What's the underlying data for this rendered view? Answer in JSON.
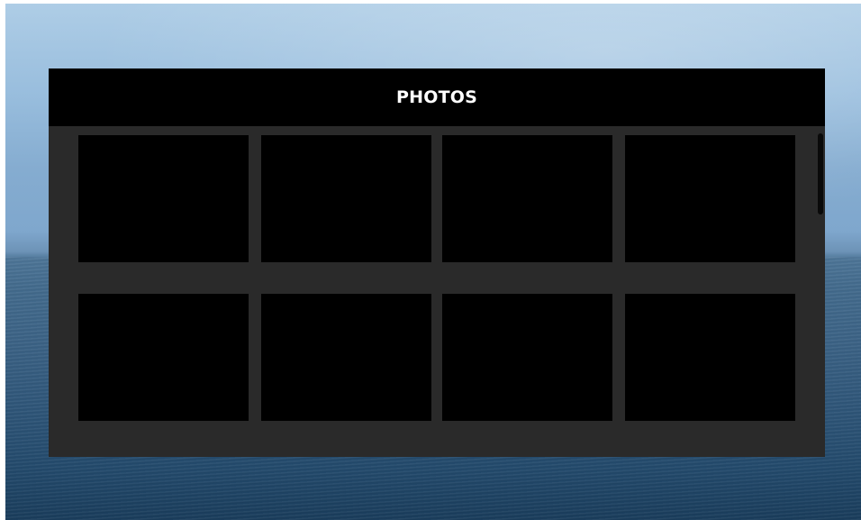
{
  "window": {
    "title": "PHOTOS"
  },
  "gallery": {
    "rows": 2,
    "columns": 4,
    "items": [
      {
        "name": "photo-thumbnail-1"
      },
      {
        "name": "photo-thumbnail-2"
      },
      {
        "name": "photo-thumbnail-3"
      },
      {
        "name": "photo-thumbnail-4"
      },
      {
        "name": "photo-thumbnail-5"
      },
      {
        "name": "photo-thumbnail-6"
      },
      {
        "name": "photo-thumbnail-7"
      },
      {
        "name": "photo-thumbnail-8"
      }
    ]
  },
  "colors": {
    "header_bg": "#000000",
    "panel_bg": "#2a2a2a",
    "thumbnail_bg": "#000000",
    "title_text": "#ffffff"
  }
}
